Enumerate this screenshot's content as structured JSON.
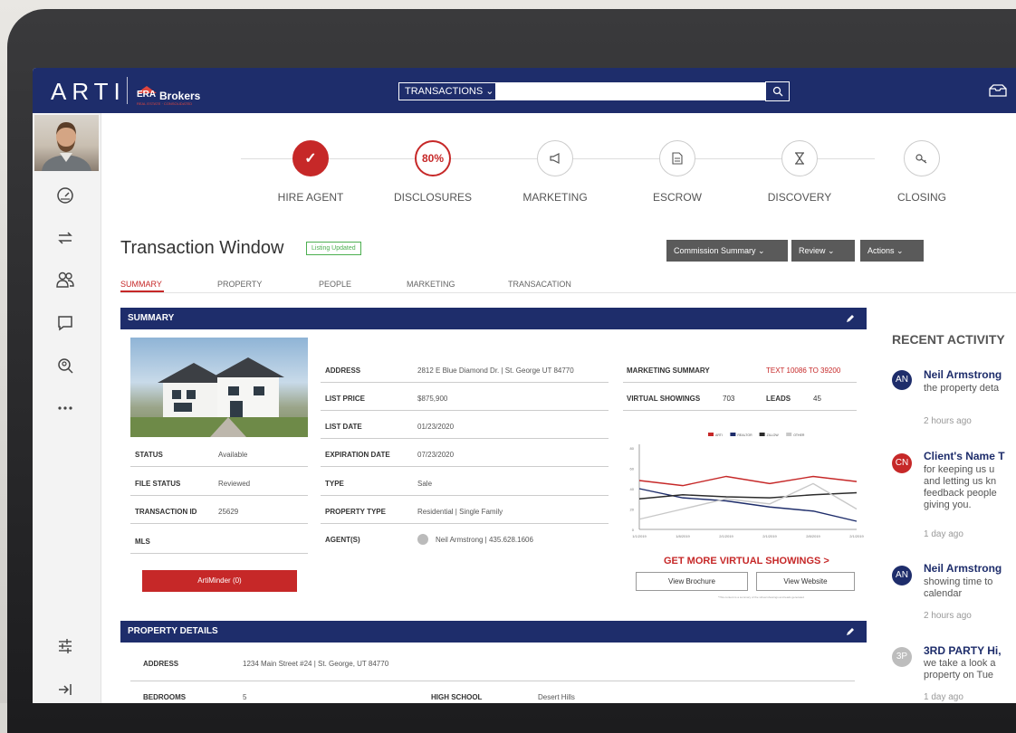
{
  "header": {
    "logo": "ARTI",
    "brand_era": "ERA",
    "brand_brokers": "Brokers",
    "brand_sub": "REAL ESTATE · CONSOLIDATED",
    "search_dropdown": "TRANSACTIONS ⌄"
  },
  "steps": [
    {
      "label": "HIRE AGENT",
      "icon": "check-icon",
      "value": "✓"
    },
    {
      "label": "DISCLOSURES",
      "icon": "percent-progress",
      "value": "80%"
    },
    {
      "label": "MARKETING",
      "icon": "megaphone-icon",
      "value": ""
    },
    {
      "label": "ESCROW",
      "icon": "document-icon",
      "value": ""
    },
    {
      "label": "DISCOVERY",
      "icon": "hourglass-icon",
      "value": ""
    },
    {
      "label": "CLOSING",
      "icon": "key-icon",
      "value": ""
    }
  ],
  "page": {
    "title": "Transaction Window",
    "badge": "Listing Updated",
    "btn_commission": "Commission Summary ⌄",
    "btn_review": "Review ⌄",
    "btn_actions": "Actions ⌄"
  },
  "tabs": [
    "SUMMARY",
    "PROPERTY",
    "PEOPLE",
    "MARKETING",
    "TRANSACATION"
  ],
  "summary": {
    "header": "SUMMARY",
    "left": [
      {
        "label": "STATUS",
        "value": "Available"
      },
      {
        "label": "FILE STATUS",
        "value": "Reviewed"
      },
      {
        "label": "TRANSACTION ID",
        "value": "25629"
      },
      {
        "label": "MLS",
        "value": ""
      }
    ],
    "mid": [
      {
        "label": "ADDRESS",
        "value": "2812 E Blue Diamond Dr. | St. George UT 84770"
      },
      {
        "label": "LIST PRICE",
        "value": "$875,900"
      },
      {
        "label": "LIST DATE",
        "value": "01/23/2020"
      },
      {
        "label": "EXPIRATION DATE",
        "value": "07/23/2020"
      },
      {
        "label": "TYPE",
        "value": "Sale"
      },
      {
        "label": "PROPERTY TYPE",
        "value": "Residential | Single Family"
      },
      {
        "label": "AGENT(S)",
        "value": "Neil Armstrong | 435.628.1606"
      }
    ],
    "marketing_summary_label": "MARKETING SUMMARY",
    "marketing_summary_value": "TEXT 10086 TO 39200",
    "virtual_showings_label": "VIRTUAL SHOWINGS",
    "virtual_showings_value": "703",
    "leads_label": "LEADS",
    "leads_value": "45",
    "artiminder": "ArtiMinder (0)",
    "cta": "GET MORE VIRTUAL SHOWINGS >",
    "btn_brochure": "View Brochure",
    "btn_website": "View Website",
    "disclaimer": "*This content is a summary of the virtual showings and leads generated"
  },
  "chart_data": {
    "type": "line",
    "categories": [
      "1/1/2019",
      "1/8/2019",
      "2/1/2019",
      "2/1/2019",
      "2/8/2019",
      "2/1/2019"
    ],
    "ylim": [
      0,
      80
    ],
    "yticks": [
      "80",
      "60",
      "40",
      "20",
      "0"
    ],
    "series": [
      {
        "name": "ARTI",
        "color": "#c62828",
        "values": [
          48,
          43,
          52,
          45,
          52,
          47
        ]
      },
      {
        "name": "REALTOR",
        "color": "#1e2d6b",
        "values": [
          40,
          31,
          28,
          22,
          18,
          8
        ]
      },
      {
        "name": "ZILLOW",
        "color": "#2b2b2b",
        "values": [
          30,
          34,
          32,
          31,
          34,
          36
        ]
      },
      {
        "name": "OTHER",
        "color": "#c8c8c8",
        "values": [
          10,
          20,
          30,
          25,
          45,
          20
        ]
      }
    ],
    "legend_position": "top",
    "grid": false
  },
  "property_details": {
    "header": "PROPERTY DETAILS",
    "rows": [
      {
        "label": "ADDRESS",
        "value": "1234 Main Street #24 | St. George, UT 84770"
      },
      {
        "label": "BEDROOMS",
        "value": "5"
      }
    ],
    "school_label": "HIGH SCHOOL",
    "school_value": "Desert Hills"
  },
  "recent_activity": {
    "title": "RECENT ACTIVITY",
    "items": [
      {
        "initials": "AN",
        "name": "Neil Armstrong",
        "lines": [
          "the property deta"
        ],
        "time": "2 hours ago",
        "color": "#1e2d6b"
      },
      {
        "initials": "CN",
        "name": "Client's Name T",
        "lines": [
          "for keeping us u",
          "and letting us kn",
          "feedback people",
          "giving you."
        ],
        "time": "1 day ago",
        "color": "#c62828"
      },
      {
        "initials": "AN",
        "name": "Neil Armstrong",
        "lines": [
          "showing time to",
          "calendar"
        ],
        "time": "2 hours ago",
        "color": "#1e2d6b"
      },
      {
        "initials": "3P",
        "name": "3RD PARTY Hi,",
        "lines": [
          "we take a look a",
          "property on Tue"
        ],
        "time": "1 day ago",
        "color": "#bdbdbd"
      }
    ]
  }
}
